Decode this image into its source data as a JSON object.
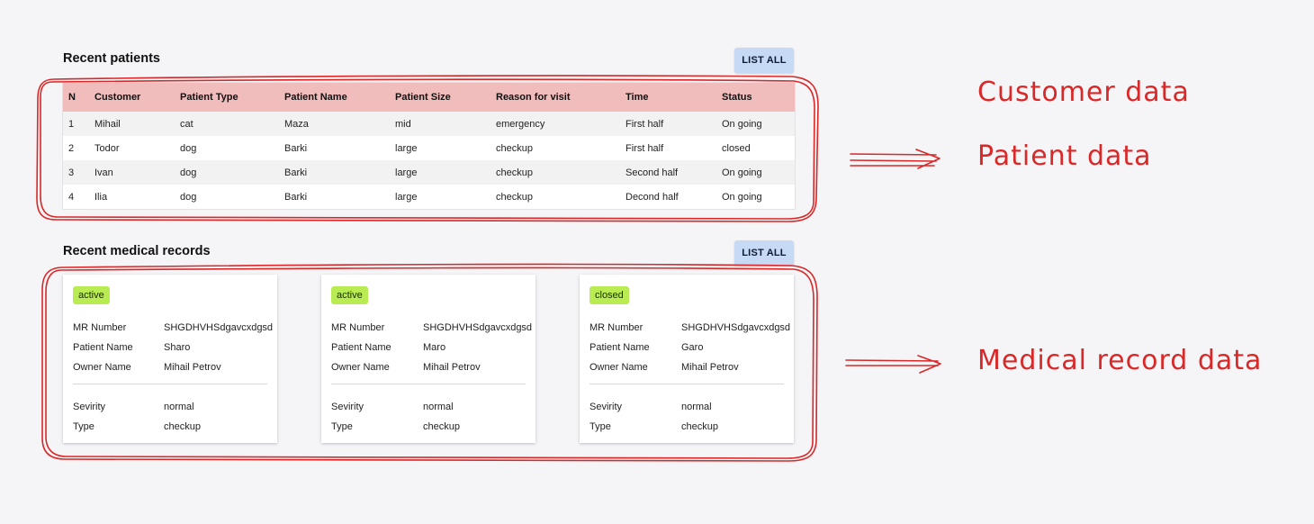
{
  "patients_section": {
    "title": "Recent patients",
    "list_all_label": "LIST ALL",
    "columns": [
      "N",
      "Customer",
      "Patient Type",
      "Patient Name",
      "Patient Size",
      "Reason for visit",
      "Time",
      "Status"
    ],
    "rows": [
      [
        "1",
        "Mihail",
        "cat",
        "Maza",
        "mid",
        "emergency",
        "First half",
        "On going"
      ],
      [
        "2",
        "Todor",
        "dog",
        "Barki",
        "large",
        "checkup",
        "First half",
        "closed"
      ],
      [
        "3",
        "Ivan",
        "dog",
        "Barki",
        "large",
        "checkup",
        "Second half",
        "On going"
      ],
      [
        "4",
        "Ilia",
        "dog",
        "Barki",
        "large",
        "checkup",
        "Decond half",
        "On going"
      ]
    ]
  },
  "records_section": {
    "title": "Recent medical records",
    "list_all_label": "LIST ALL",
    "field_labels": {
      "mr_number": "MR Number",
      "patient_name": "Patient Name",
      "owner_name": "Owner Name",
      "severity": "Sevirity",
      "type": "Type"
    },
    "cards": [
      {
        "status": "active",
        "mr_number": "SHGDHVHSdgavcxdgsd",
        "patient_name": "Sharo",
        "owner_name": "Mihail Petrov",
        "severity": "normal",
        "type": "checkup"
      },
      {
        "status": "active",
        "mr_number": "SHGDHVHSdgavcxdgsd",
        "patient_name": "Maro",
        "owner_name": "Mihail Petrov",
        "severity": "normal",
        "type": "checkup"
      },
      {
        "status": "closed",
        "mr_number": "SHGDHVHSdgavcxdgsd",
        "patient_name": "Garo",
        "owner_name": "Mihail Petrov",
        "severity": "normal",
        "type": "checkup"
      }
    ]
  },
  "annotations": {
    "customer": "Customer data",
    "patient": "Patient data",
    "medical": "Medical record data"
  },
  "colors": {
    "header_row": "#f0bcbc",
    "button": "#c6daf6",
    "badge": "#b8ec52",
    "annotation": "#d92828"
  }
}
